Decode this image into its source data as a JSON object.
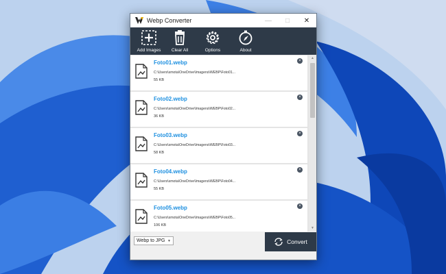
{
  "window": {
    "title": "Webp Converter"
  },
  "toolbar": {
    "add_images": "Add Images",
    "clear_all": "Clear All",
    "options": "Options",
    "about": "About"
  },
  "files": [
    {
      "name": "Foto01.webp",
      "path": "C:\\Users\\smota\\OneDrive\\Imagens\\WEBP\\Foto01...",
      "size": "55 KB"
    },
    {
      "name": "Foto02.webp",
      "path": "C:\\Users\\smota\\OneDrive\\Imagens\\WEBP\\Foto02...",
      "size": "36 KB"
    },
    {
      "name": "Foto03.webp",
      "path": "C:\\Users\\smota\\OneDrive\\Imagens\\WEBP\\Foto03...",
      "size": "58 KB"
    },
    {
      "name": "Foto04.webp",
      "path": "C:\\Users\\smota\\OneDrive\\Imagens\\WEBP\\Foto04...",
      "size": "55 KB"
    },
    {
      "name": "Foto05.webp",
      "path": "C:\\Users\\smota\\OneDrive\\Imagens\\WEBP\\Foto05...",
      "size": "106 KB"
    }
  ],
  "bottom": {
    "format_value": "Webp to JPG",
    "convert_label": "Convert"
  },
  "colors": {
    "accent": "#1e90e0",
    "dark": "#2e3a48",
    "wallpaper": "#2a6fd6"
  }
}
